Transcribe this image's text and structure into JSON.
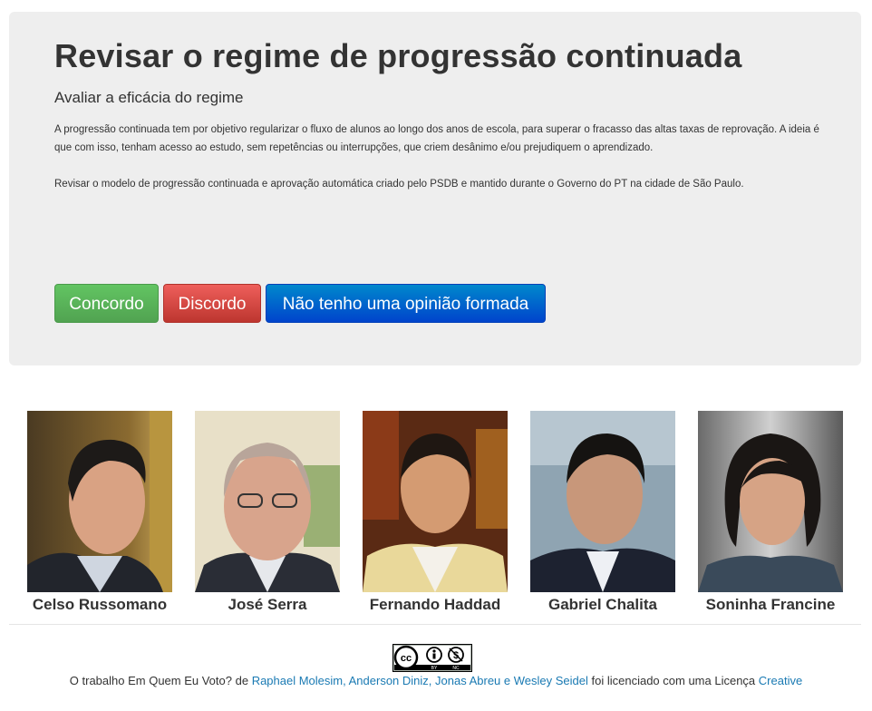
{
  "proposal": {
    "title": "Revisar o regime de progressão continuada",
    "subtitle": "Avaliar a eficácia do regime",
    "description": "A progressão continuada tem por objetivo regularizar o fluxo de alunos ao longo dos anos de escola, para superar o fracasso das altas taxas de reprovação. A ideia é que com isso, tenham acesso ao estudo, sem repetências ou interrupções, que criem desânimo e/ou prejudiquem o aprendizado.",
    "description2": "Revisar o modelo de progressão continuada e aprovação automática criado pelo PSDB e mantido durante o Governo do PT na cidade de São Paulo."
  },
  "buttons": {
    "agree": "Concordo",
    "disagree": "Discordo",
    "neutral": "Não tenho uma opinião formada"
  },
  "colors": {
    "agree": "#51a351",
    "disagree": "#bd362f",
    "neutral": "#0055cc",
    "link": "#1a7ab3",
    "hero_bg": "#eeeeee"
  },
  "candidates": [
    {
      "name": "Celso Russomano"
    },
    {
      "name": "José Serra"
    },
    {
      "name": "Fernando Haddad"
    },
    {
      "name": "Gabriel Chalita"
    },
    {
      "name": "Soninha Francine"
    }
  ],
  "footer": {
    "license_badge": "cc-by-nc-icon",
    "prefix": "O trabalho Em Quem Eu Voto? de",
    "authors_link": "Raphael Molesim, Anderson Diniz, Jonas Abreu e Wesley Seidel",
    "middle": "foi licenciado com uma Licença",
    "license_link": "Creative"
  }
}
